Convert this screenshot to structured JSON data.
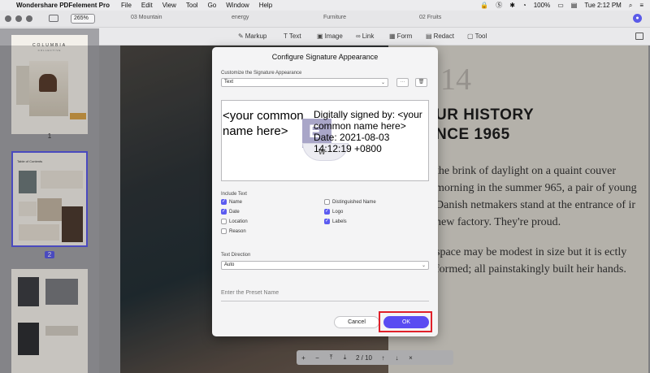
{
  "menubar": {
    "app_name": "Wondershare PDFelement Pro",
    "items": [
      "File",
      "Edit",
      "View",
      "Tool",
      "Go",
      "Window",
      "Help"
    ],
    "battery": "100%",
    "clock": "Tue 2:12 PM"
  },
  "tabs": [
    "03 Mountain",
    "energy",
    "Furniture",
    "02 Fruits"
  ],
  "zoom": "265%",
  "toolbar": {
    "tools": [
      "Markup",
      "Text",
      "Image",
      "Link",
      "Form",
      "Redact",
      "Tool"
    ]
  },
  "thumbnails": {
    "page1_num": "1",
    "page2_num": "2",
    "thumb1_title": "COLUMBIA",
    "thumb1_sub": "COLLECTIVE",
    "thumb2_title": "Table of Contents"
  },
  "document": {
    "big_number": "14",
    "heading_line1": "UR HISTORY",
    "heading_line2": "NCE 1965",
    "para1": "the brink of daylight on a quaint couver morning in the summer 965, a pair of young Danish netmakers stand at the entrance of ir new factory. They're proud.",
    "para2": "space may be modest in size but it is ectly formed; all painstakingly built heir hands."
  },
  "pager": {
    "zoom_in": "+",
    "zoom_out": "−",
    "first": "⤒",
    "prev": "⤓",
    "page_display": "2 / 10",
    "up": "↑",
    "down": "↓",
    "close": "×"
  },
  "dialog": {
    "title": "Configure Signature Appearance",
    "customize_label": "Customize the Signature Appearance",
    "customize_value": "Text",
    "more_button": "···",
    "preview": {
      "name_text": "<your common name here>",
      "details_text": "Digitally signed by: <your common name here> Date: 2021-08-03 14:12:19 +0800"
    },
    "include_text_label": "Include Text",
    "options": [
      {
        "label": "Name",
        "checked": true
      },
      {
        "label": "Distinguished Name",
        "checked": false
      },
      {
        "label": "Date",
        "checked": true
      },
      {
        "label": "Logo",
        "checked": true
      },
      {
        "label": "Location",
        "checked": false
      },
      {
        "label": "Labels",
        "checked": true
      },
      {
        "label": "Reason",
        "checked": false
      }
    ],
    "text_direction_label": "Text Direction",
    "text_direction_value": "Auto",
    "preset_placeholder": "Enter the Preset Name",
    "cancel_label": "Cancel",
    "ok_label": "OK",
    "accent_color": "#5a4cf2",
    "highlight_color": "#e0202a"
  }
}
